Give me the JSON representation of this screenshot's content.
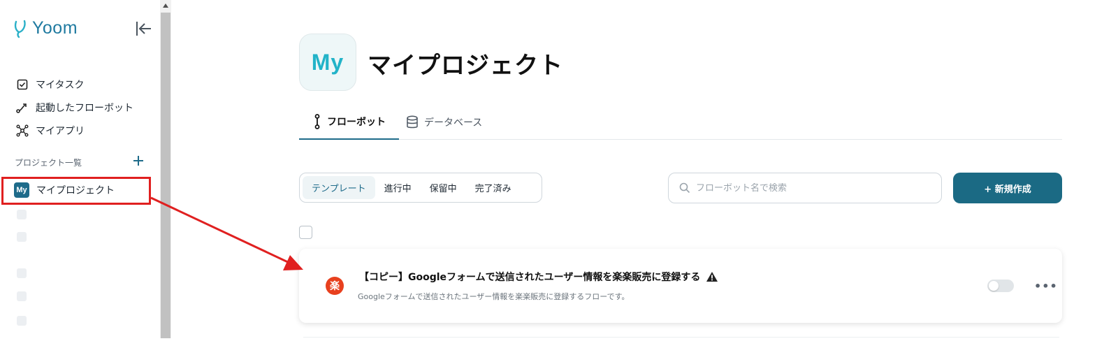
{
  "brand": {
    "name": "Yoom",
    "color": "#1f7aa0"
  },
  "sidebar": {
    "nav": [
      {
        "label": "マイタスク",
        "icon": "checkbox-icon"
      },
      {
        "label": "起動したフローボット",
        "icon": "flow-run-icon"
      },
      {
        "label": "マイアプリ",
        "icon": "apps-network-icon"
      }
    ],
    "section_title": "プロジェクト一覧",
    "active_project": {
      "badge": "My",
      "label": "マイプロジェクト"
    }
  },
  "project": {
    "avatar": "My",
    "title": "マイプロジェクト"
  },
  "tabs": [
    {
      "label": "フローボット",
      "active": true
    },
    {
      "label": "データベース",
      "active": false
    }
  ],
  "filters": [
    {
      "label": "テンプレート",
      "active": true
    },
    {
      "label": "進行中",
      "active": false
    },
    {
      "label": "保留中",
      "active": false
    },
    {
      "label": "完了済み",
      "active": false
    }
  ],
  "search": {
    "placeholder": "フローボット名で検索",
    "value": ""
  },
  "new_button": {
    "label": "+ 新規作成"
  },
  "flows": [
    {
      "icon_text": "楽",
      "title": "【コピー】Googleフォームで送信されたユーザー情報を楽楽販売に登録する",
      "description": "Googleフォームで送信されたユーザー情報を楽楽販売に登録するフローです。",
      "warning": true,
      "enabled": false
    }
  ],
  "colors": {
    "primary": "#1b6a84",
    "accent_cyan": "#22b3c8",
    "annotation_red": "#e02020",
    "flow_icon": "#e8401e"
  }
}
